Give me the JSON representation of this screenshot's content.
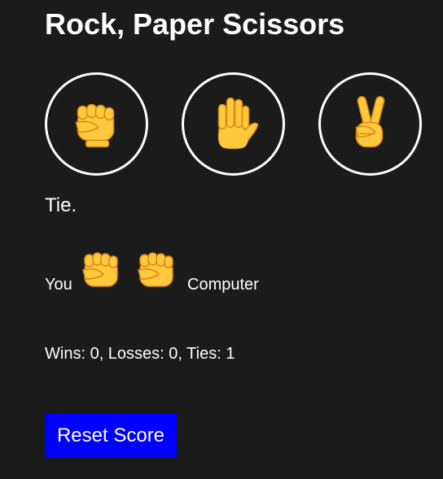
{
  "title": "Rock, Paper Scissors",
  "choices": [
    {
      "name": "rock",
      "icon": "raised-fist-icon"
    },
    {
      "name": "paper",
      "icon": "raised-hand-icon"
    },
    {
      "name": "scissors",
      "icon": "victory-hand-icon"
    }
  ],
  "result": "Tie.",
  "moves": {
    "you_label": "You",
    "computer_label": "Computer",
    "player_icon": "raised-fist-icon",
    "computer_icon": "raised-fist-icon"
  },
  "score": {
    "wins_label": "Wins: ",
    "wins": "0",
    "losses_label": ", Losses: ",
    "losses": "0",
    "ties_label": ", Ties: ",
    "ties": "1"
  },
  "reset_label": "Reset Score",
  "colors": {
    "background": "#1b1b1b",
    "text": "#ffffff",
    "reset_button": "#0000ff",
    "emoji_fill": "#ffc83d",
    "emoji_outline": "#d68a16"
  }
}
